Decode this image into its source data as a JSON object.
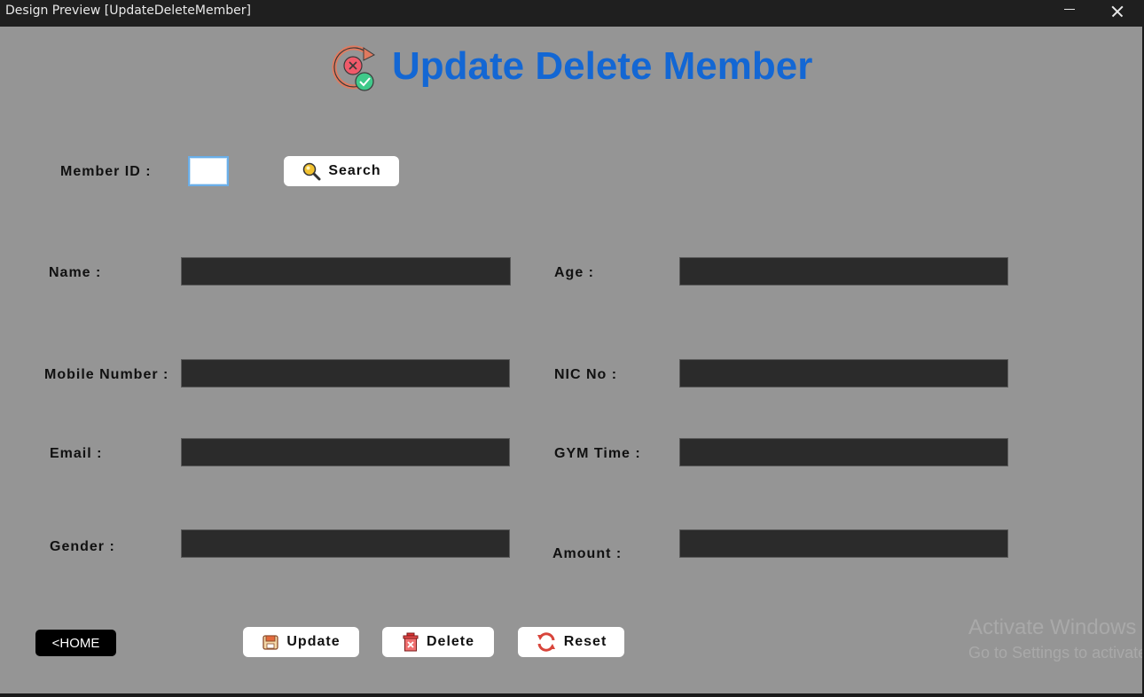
{
  "window": {
    "title": "Design Preview [UpdateDeleteMember]"
  },
  "header": {
    "title": "Update Delete Member",
    "icon": "update-delete-member-icon"
  },
  "search": {
    "label": "Member ID :",
    "value": "",
    "button_label": "Search",
    "button_icon": "magnifier-icon"
  },
  "form": {
    "name": {
      "label": "Name :",
      "value": ""
    },
    "age": {
      "label": "Age :",
      "value": ""
    },
    "mobile": {
      "label": "Mobile Number :",
      "value": ""
    },
    "nic": {
      "label": "NIC No :",
      "value": ""
    },
    "email": {
      "label": "Email :",
      "value": ""
    },
    "gym_time": {
      "label": "GYM Time :",
      "value": ""
    },
    "gender": {
      "label": "Gender :",
      "value": ""
    },
    "amount": {
      "label": "Amount :",
      "value": ""
    }
  },
  "actions": {
    "home_label": "<HOME",
    "update_label": "Update",
    "delete_label": "Delete",
    "reset_label": "Reset"
  },
  "watermark": {
    "line1": "Activate Windows",
    "line2": "Go to Settings to activate Windows."
  },
  "colors": {
    "background": "#959595",
    "title": "#1367d4",
    "field": "#2b2b2b"
  }
}
